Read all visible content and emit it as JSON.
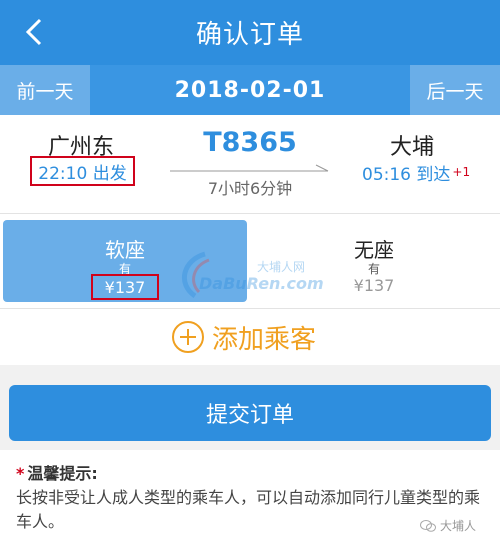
{
  "header": {
    "title": "确认订单",
    "back_icon": "chevron-left-icon"
  },
  "datebar": {
    "prev_label": "前一天",
    "date": "2018-02-01",
    "next_label": "后一天"
  },
  "trip": {
    "from_station": "广州东",
    "depart_text": "22:10 出发",
    "train_number": "T8365",
    "duration": "7小时6分钟",
    "to_station": "大埔",
    "arrive_text": "05:16 到达",
    "plus_day": "+1"
  },
  "seats": [
    {
      "name": "软座",
      "availability": "有",
      "price": "¥137",
      "selected": true
    },
    {
      "name": "无座",
      "availability": "有",
      "price": "¥137",
      "selected": false
    }
  ],
  "watermark": {
    "cn": "大埔人网",
    "en": "DaBuRen.com"
  },
  "add_passenger": {
    "label": "添加乘客",
    "icon": "plus-circle-icon"
  },
  "submit": {
    "label": "提交订单"
  },
  "tips": {
    "star": "*",
    "title": "温馨提示:",
    "body": "长按非受让人成人类型的乘车人，可以自动添加同行儿童类型的乘车人。"
  },
  "footer": {
    "wechat_label": "大埔人"
  },
  "colors": {
    "primary": "#2e8ede",
    "accent": "#f0a020",
    "highlight_box": "#d0021b"
  }
}
